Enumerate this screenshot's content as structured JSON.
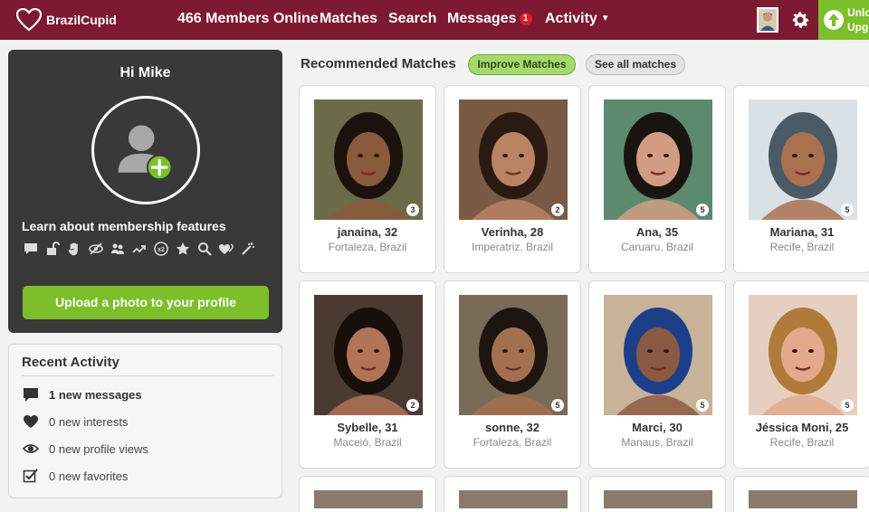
{
  "brand": {
    "name": "BrazilCupid"
  },
  "nav": {
    "members_online": "466 Members Online",
    "matches": "Matches",
    "search": "Search",
    "messages": "Messages",
    "messages_badge": "1",
    "activity": "Activity"
  },
  "upgrade": {
    "line1": "Unlo",
    "line2": "Upg"
  },
  "profile": {
    "greeting": "Hi Mike",
    "learn": "Learn about membership features",
    "upload_button": "Upload a photo to your profile",
    "feature_icons": [
      "chat-icon",
      "unlock-icon",
      "hand-icon",
      "hide-icon",
      "users-icon",
      "trend-icon",
      "x2-icon",
      "star-icon",
      "search-icon",
      "hearts-icon",
      "wand-icon"
    ]
  },
  "recent_activity": {
    "title": "Recent Activity",
    "items": [
      {
        "icon": "message-icon",
        "text": "1 new messages"
      },
      {
        "icon": "heart-icon",
        "text": "0 new interests"
      },
      {
        "icon": "eye-icon",
        "text": "0 new profile views"
      },
      {
        "icon": "checkbox-icon",
        "text": "0 new favorites"
      }
    ]
  },
  "recommended": {
    "title": "Recommended Matches",
    "improve_button": "Improve Matches",
    "see_all_button": "See all matches",
    "matches": [
      {
        "name": "janaina, 32",
        "location": "Fortaleza, Brazil",
        "photos": "3",
        "bg": "#6b6b4a",
        "skin": "#8a5a3c",
        "hair": "#1c120c"
      },
      {
        "name": "Verinha, 28",
        "location": "Imperatriz, Brazil",
        "photos": "2",
        "bg": "#7a5a44",
        "skin": "#b98364",
        "hair": "#2b1a12"
      },
      {
        "name": "Ana, 35",
        "location": "Caruaru, Brazil",
        "photos": "5",
        "bg": "#5c8a6e",
        "skin": "#d29c83",
        "hair": "#1a1410"
      },
      {
        "name": "Mariana, 31",
        "location": "Recife, Brazil",
        "photos": "5",
        "bg": "#d9e0e6",
        "skin": "#a9714f",
        "hair": "#4a5a66"
      },
      {
        "name": "Sybelle, 31",
        "location": "Maceió, Brazil",
        "photos": "2",
        "bg": "#4a3a32",
        "skin": "#b27457",
        "hair": "#180f0b"
      },
      {
        "name": "sonne, 32",
        "location": "Fortaleza, Brazil",
        "photos": "5",
        "bg": "#7a6a58",
        "skin": "#a3704f",
        "hair": "#1e1510"
      },
      {
        "name": "Marci, 30",
        "location": "Manaus, Brazil",
        "photos": "5",
        "bg": "#c8b29a",
        "skin": "#8c5a42",
        "hair": "#1d3f8a"
      },
      {
        "name": "Jéssica Moni, 25",
        "location": "Recife, Brazil",
        "photos": "5",
        "bg": "#e6cfc0",
        "skin": "#e2a98c",
        "hair": "#b07a3a"
      }
    ]
  }
}
